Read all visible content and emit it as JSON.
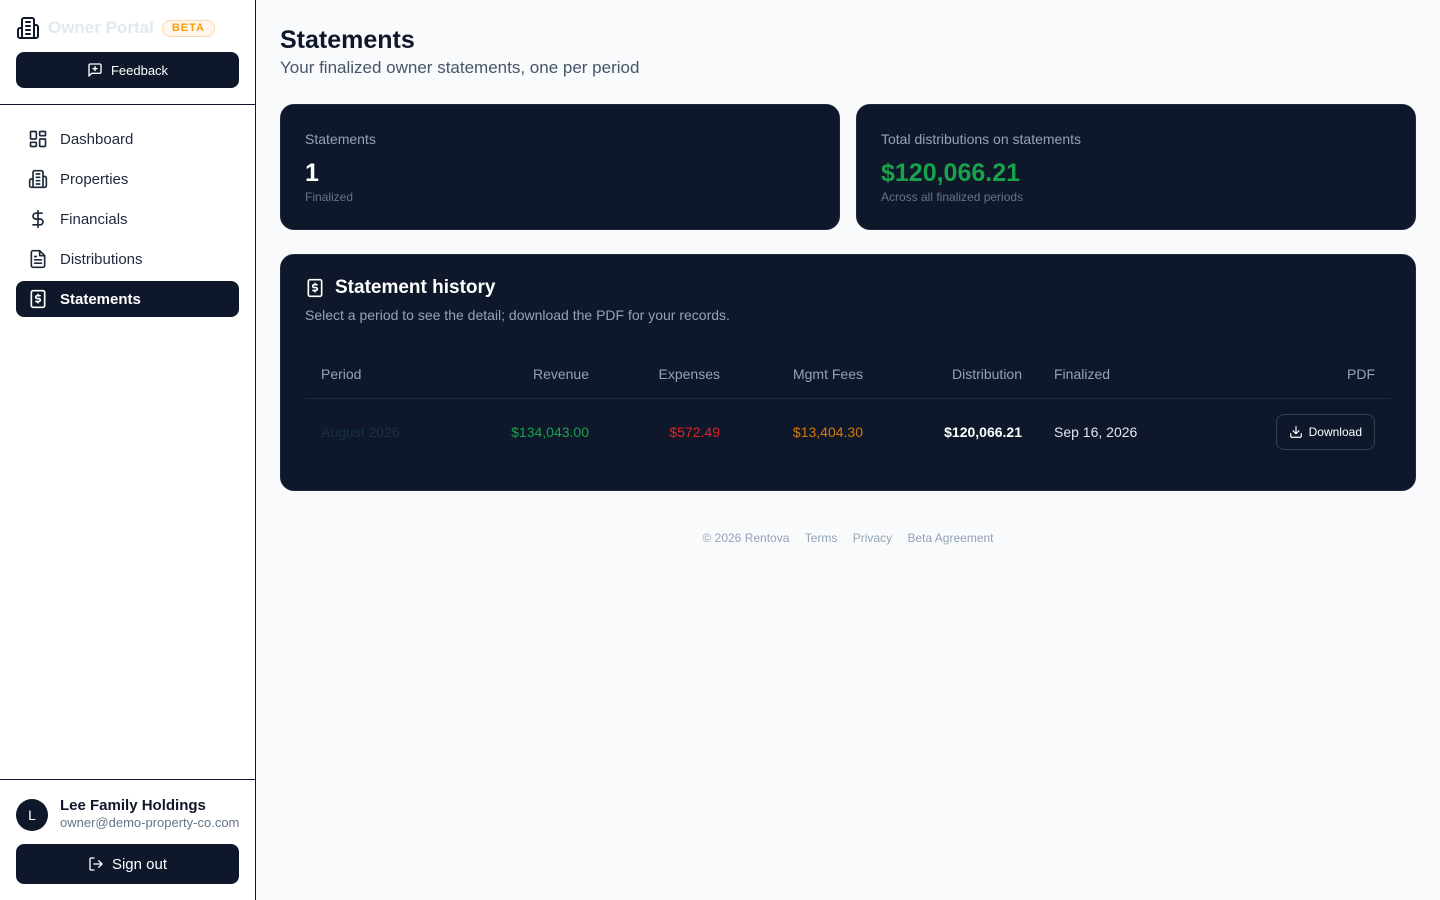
{
  "brand": {
    "title": "Owner Portal",
    "badge": "BETA"
  },
  "feedback_label": "Feedback",
  "nav": [
    {
      "label": "Dashboard",
      "icon": "dashboard-icon"
    },
    {
      "label": "Properties",
      "icon": "building-icon"
    },
    {
      "label": "Financials",
      "icon": "dollar-icon"
    },
    {
      "label": "Distributions",
      "icon": "document-icon"
    },
    {
      "label": "Statements",
      "icon": "statement-icon",
      "active": true
    }
  ],
  "user": {
    "initial": "L",
    "name": "Lee Family Holdings",
    "email": "owner@demo-property-co.com"
  },
  "signout_label": "Sign out",
  "page": {
    "title": "Statements",
    "subtitle": "Your finalized owner statements, one per period"
  },
  "stats": [
    {
      "label": "Statements",
      "value": "1",
      "sub": "Finalized"
    },
    {
      "label": "Total distributions on statements",
      "value": "$120,066.21",
      "sub": "Across all finalized periods"
    }
  ],
  "history": {
    "title": "Statement history",
    "subtitle": "Select a period to see the detail; download the PDF for your records.",
    "columns": [
      "Period",
      "Revenue",
      "Expenses",
      "Mgmt Fees",
      "Distribution",
      "Finalized",
      "PDF"
    ],
    "rows": [
      {
        "period": "August 2026",
        "revenue": "$134,043.00",
        "expenses": "$572.49",
        "fees": "$13,404.30",
        "distribution": "$120,066.21",
        "finalized": "Sep 16, 2026",
        "pdf_label": "Download"
      }
    ]
  },
  "footer": {
    "copyright": "© 2026 Rentova",
    "links": [
      "Terms",
      "Privacy",
      "Beta Agreement"
    ]
  },
  "colors": {
    "primary": "#0f172a",
    "positive": "#16a34a",
    "negative": "#dc2626",
    "warning": "#d97706"
  }
}
